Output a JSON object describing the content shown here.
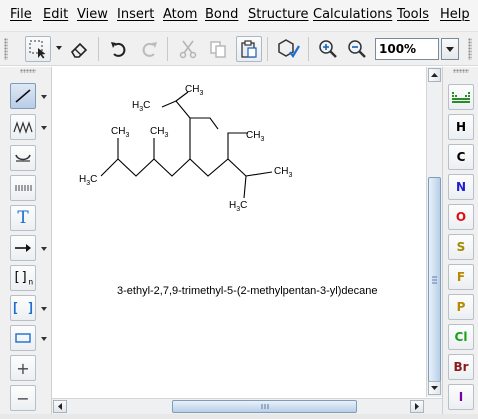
{
  "menu": [
    "File",
    "Edit",
    "View",
    "Insert",
    "Atom",
    "Bond",
    "Structure",
    "Calculations",
    "Tools",
    "Help"
  ],
  "toolbar": {
    "zoom_value": "100%",
    "icons": [
      "selection-icon",
      "eraser-icon",
      "undo-icon",
      "redo-icon",
      "cut-icon",
      "copy-icon",
      "paste-icon",
      "clean-structure-icon",
      "zoom-in-icon",
      "zoom-out-icon"
    ]
  },
  "left_tools": {
    "text_tool_label": "T",
    "bracket_label": "[]",
    "bracket_subscript": "n",
    "bracket_sq_label": "[ ]",
    "plus_label": "+",
    "minus_label": "−"
  },
  "atoms": [
    {
      "symbol": "H",
      "color": "#000000"
    },
    {
      "symbol": "C",
      "color": "#000000"
    },
    {
      "symbol": "N",
      "color": "#1f1fd0"
    },
    {
      "symbol": "O",
      "color": "#e01010"
    },
    {
      "symbol": "S",
      "color": "#a08a00"
    },
    {
      "symbol": "F",
      "color": "#b88a00"
    },
    {
      "symbol": "P",
      "color": "#b88a00"
    },
    {
      "symbol": "Cl",
      "color": "#1aa01a"
    },
    {
      "symbol": "Br",
      "color": "#8a1a1a"
    },
    {
      "symbol": "I",
      "color": "#7a00a0"
    }
  ],
  "molecule": {
    "name": "3-ethyl-2,7,9-trimethyl-5-(2-methylpentan-3-yl)decane",
    "labels": {
      "ch3_top": "CH",
      "h3c_upper": "H",
      "ch3_left1": "CH",
      "ch3_left2": "CH",
      "ch3_right_upper": "CH",
      "h3c_lower_left": "H",
      "ch3_right_lower": "CH",
      "h3c_bottom": "H",
      "c_label": "C",
      "sub3": "3"
    }
  },
  "colors": {
    "accent": "#1a7fd4",
    "bond": "#000000"
  }
}
